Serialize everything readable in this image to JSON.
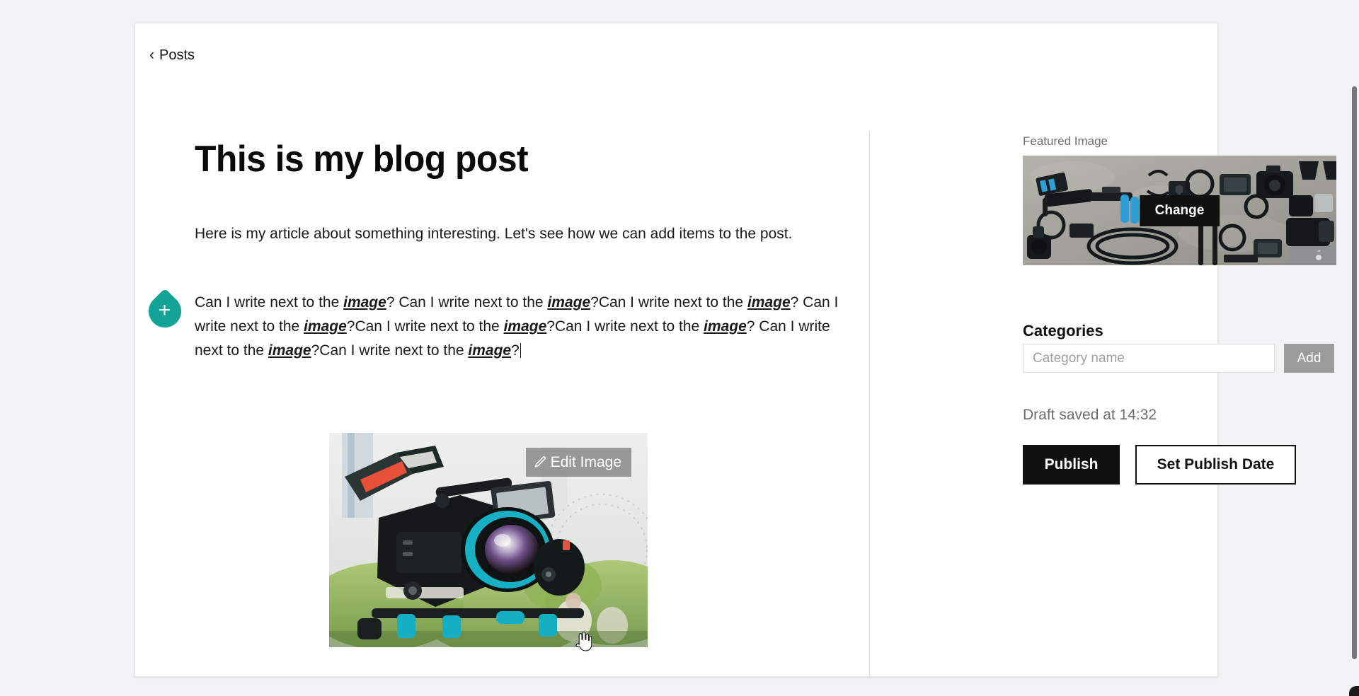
{
  "app": {
    "background_color": "#f1f3f4",
    "card_background": "#ffffff"
  },
  "nav": {
    "back_label": "Posts",
    "back_chevron": "chevron-left-icon"
  },
  "post": {
    "title": "This is my blog post",
    "intro_paragraph": "Here is my article about something interesting. Let's see how we can add items to the post.",
    "body_segments": [
      {
        "text": "Can I write next to the "
      },
      {
        "text": "image",
        "style": "bold-italic-underline"
      },
      {
        "text": "? Can I write next to the "
      },
      {
        "text": "image",
        "style": "bold-italic-underline"
      },
      {
        "text": "?Can I write next to the "
      },
      {
        "text": "image",
        "style": "bold-italic-underline"
      },
      {
        "text": "? Can I write next to the "
      },
      {
        "text": "image",
        "style": "bold-italic-underline"
      },
      {
        "text": "?Can I write next to the "
      },
      {
        "text": "image",
        "style": "bold-italic-underline"
      },
      {
        "text": "?Can I write next to the "
      },
      {
        "text": "image",
        "style": "bold-italic-underline"
      },
      {
        "text": "? Can I write next to the "
      },
      {
        "text": "image",
        "style": "bold-italic-underline"
      },
      {
        "text": "?Can I write next to the "
      },
      {
        "text": "image",
        "style": "bold-italic-underline"
      },
      {
        "text": "?"
      }
    ],
    "caret_visible": true
  },
  "block_handle": {
    "icon": "plus-icon",
    "glyph": "+",
    "color": "#13a396"
  },
  "inline_image": {
    "alt": "cinema camera rig on tripod in a park",
    "edit_button_label": "Edit Image",
    "edit_button_icon": "pencil-icon"
  },
  "cursor": {
    "type": "pointer-hand-cursor"
  },
  "sidebar": {
    "featured_label": "Featured Image",
    "featured_image_alt": "flat lay of camera gear on concrete",
    "change_label": "Change",
    "categories_heading": "Categories",
    "category_placeholder": "Category name",
    "category_value": "",
    "add_label": "Add",
    "draft_status": "Draft saved at 14:32",
    "publish_label": "Publish",
    "set_publish_date_label": "Set Publish Date"
  },
  "colors": {
    "accent_green": "#13a396",
    "button_dark": "#111111",
    "add_gray": "#9b9b9b",
    "muted_text": "#6b6b6b"
  }
}
